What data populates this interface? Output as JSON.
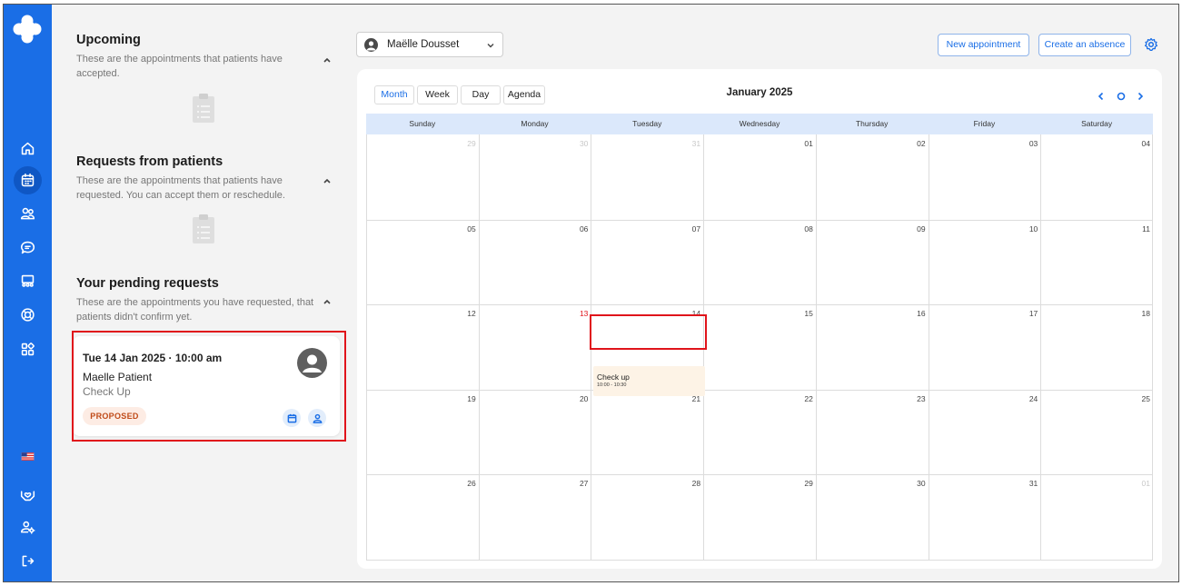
{
  "sidebar": {
    "icons": [
      "plus-logo",
      "home-icon",
      "calendar-icon",
      "users-icon",
      "chat-icon",
      "team-icon",
      "support-icon",
      "apps-icon",
      "us-flag-icon",
      "care-icon",
      "user-settings-icon",
      "logout-icon"
    ]
  },
  "upcoming": {
    "title": "Upcoming",
    "description": "These are the appointments that patients have accepted."
  },
  "requests": {
    "title": "Requests from patients",
    "description": "These are the appointments that patients have requested. You can accept them or reschedule."
  },
  "pending": {
    "title": "Your pending requests",
    "description": "These are the appointments you have requested, that patients didn't confirm yet.",
    "card": {
      "when": "Tue 14 Jan 2025 · 10:00 am",
      "patient": "Maelle Patient",
      "type": "Check Up",
      "status": "PROPOSED"
    }
  },
  "topbar": {
    "user": "Maëlle Dousset",
    "new_appointment": "New appointment",
    "create_absence": "Create an absence"
  },
  "calendar": {
    "views": [
      "Month",
      "Week",
      "Day",
      "Agenda"
    ],
    "active_view": "Month",
    "title": "January 2025",
    "weekdays": [
      "Sunday",
      "Monday",
      "Tuesday",
      "Wednesday",
      "Thursday",
      "Friday",
      "Saturday"
    ],
    "weeks": [
      [
        "29",
        "30",
        "31",
        "01",
        "02",
        "03",
        "04"
      ],
      [
        "05",
        "06",
        "07",
        "08",
        "09",
        "10",
        "11"
      ],
      [
        "12",
        "13",
        "14",
        "15",
        "16",
        "17",
        "18"
      ],
      [
        "19",
        "20",
        "21",
        "22",
        "23",
        "24",
        "25"
      ],
      [
        "26",
        "27",
        "28",
        "29",
        "30",
        "31",
        "01"
      ]
    ],
    "today": "13",
    "event": {
      "title": "Check up",
      "time": "10:00 - 10:30"
    }
  },
  "colors": {
    "sidebar": "#1a6ee6",
    "accent": "#1a6ee6",
    "highlight": "#e0141b",
    "event_bg": "#fdf3e6",
    "badge_bg": "#fdece4",
    "badge_text": "#c04a18"
  }
}
